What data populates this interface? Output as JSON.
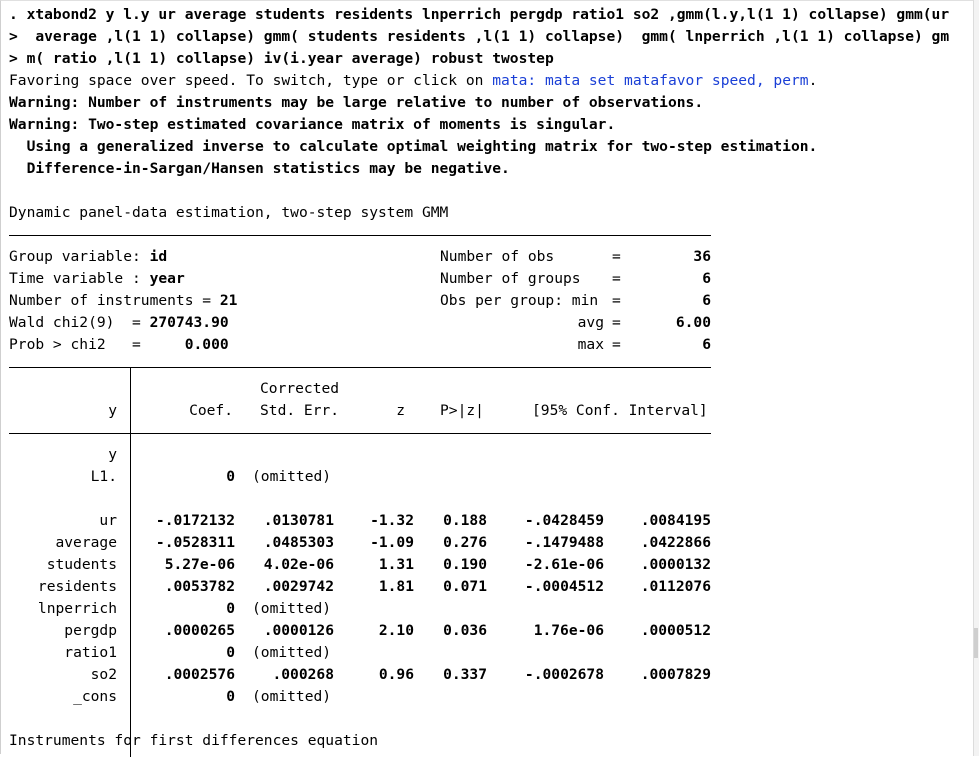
{
  "command_lines": [
    ". xtabond2 y l.y ur average students residents lnperrich pergdp ratio1 so2 ,gmm(l.y,l(1 1) collapse) gmm(ur",
    ">  average ,l(1 1) collapse) gmm( students residents ,l(1 1) collapse)  gmm( lnperrich ,l(1 1) collapse) gm",
    "> m( ratio ,l(1 1) collapse) iv(i.year average) robust twostep"
  ],
  "favoring": {
    "prefix": "Favoring space over speed. To switch, type or click on ",
    "link": "mata: mata set matafavor speed, perm",
    "suffix": "."
  },
  "warnings": [
    "Warning: Number of instruments may be large relative to number of observations.",
    "Warning: Two-step estimated covariance matrix of moments is singular.",
    "  Using a generalized inverse to calculate optimal weighting matrix for two-step estimation.",
    "  Difference-in-Sargan/Hansen statistics may be negative."
  ],
  "title": "Dynamic panel-data estimation, two-step system GMM",
  "header_left": [
    {
      "label": "Group variable: ",
      "value": "id"
    },
    {
      "label": "Time variable : ",
      "value": "year"
    },
    {
      "label": "Number of instruments = ",
      "value": "21"
    },
    {
      "label": "Wald chi2(9)  = ",
      "value": "270743.90",
      "label_bold": "9"
    },
    {
      "label": "Prob > chi2   =     ",
      "value": "0.000"
    }
  ],
  "header_right": [
    {
      "label": "Number of obs",
      "value": "36"
    },
    {
      "label": "Number of groups",
      "value": "6"
    },
    {
      "label": "Obs per group: min",
      "value": "6"
    },
    {
      "label": "avg",
      "value": "6.00"
    },
    {
      "label": "max",
      "value": "6"
    }
  ],
  "table": {
    "depvar": "y",
    "col_top": "Corrected",
    "cols": [
      "Coef.",
      "Std. Err.",
      "z",
      "P>|z|",
      "[95% Conf. Interval]"
    ],
    "group_label": "y",
    "l1": {
      "name": "L1.",
      "coef": "0",
      "se": "(omitted)"
    },
    "rows": [
      {
        "name": "ur",
        "coef": "-.0172132",
        "se": ".0130781",
        "z": "-1.32",
        "p": "0.188",
        "lo": "-.0428459",
        "hi": ".0084195"
      },
      {
        "name": "average",
        "coef": "-.0528311",
        "se": ".0485303",
        "z": "-1.09",
        "p": "0.276",
        "lo": "-.1479488",
        "hi": ".0422866"
      },
      {
        "name": "students",
        "coef": "5.27e-06",
        "se": "4.02e-06",
        "z": "1.31",
        "p": "0.190",
        "lo": "-2.61e-06",
        "hi": ".0000132"
      },
      {
        "name": "residents",
        "coef": ".0053782",
        "se": ".0029742",
        "z": "1.81",
        "p": "0.071",
        "lo": "-.0004512",
        "hi": ".0112076"
      },
      {
        "name": "lnperrich",
        "coef": "0",
        "se": "(omitted)",
        "z": "",
        "p": "",
        "lo": "",
        "hi": ""
      },
      {
        "name": "pergdp",
        "coef": ".0000265",
        "se": ".0000126",
        "z": "2.10",
        "p": "0.036",
        "lo": "1.76e-06",
        "hi": ".0000512"
      },
      {
        "name": "ratio1",
        "coef": "0",
        "se": "(omitted)",
        "z": "",
        "p": "",
        "lo": "",
        "hi": ""
      },
      {
        "name": "so2",
        "coef": ".0002576",
        "se": ".000268",
        "z": "0.96",
        "p": "0.337",
        "lo": "-.0002678",
        "hi": ".0007829"
      },
      {
        "name": "_cons",
        "coef": "0",
        "se": "(omitted)",
        "z": "",
        "p": "",
        "lo": "",
        "hi": ""
      }
    ]
  },
  "footer": "Instruments for first differences equation",
  "colors": {
    "text": "#000000",
    "link": "#1a3fd6",
    "background": "#ffffff"
  }
}
